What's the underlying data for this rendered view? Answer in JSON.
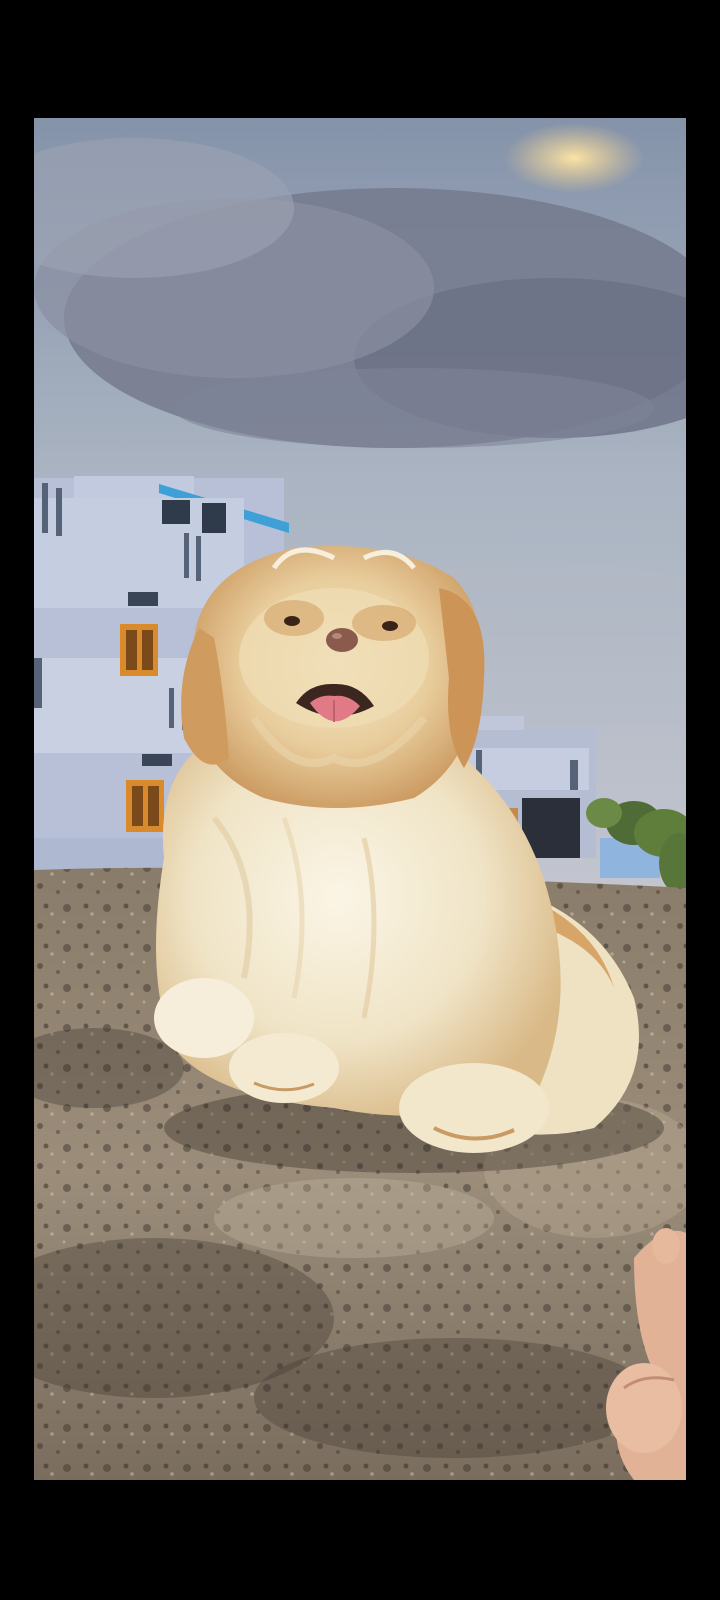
{
  "viewer": {
    "mode": "fullscreen-image",
    "background": "#000000"
  },
  "photo": {
    "subject": "dog-icon",
    "scene": [
      "sky",
      "clouds",
      "building",
      "trees",
      "stone-surface",
      "fingertip"
    ],
    "colors": {
      "sky_top": "#7f8fa6",
      "sky_mid": "#b7c0cc",
      "sky_bottom": "#c9ccd4",
      "cloud": "#6f7487",
      "cloud_highlight": "#f2cf8a",
      "building": "#b9c2d9",
      "building_trim": "#3ea0d6",
      "window": "#d98a2b",
      "ground_light": "#a89a88",
      "ground_dark": "#4a4038",
      "fur_light": "#f3ead2",
      "fur_tan": "#d8a56a",
      "nose": "#8a5a4c",
      "tongue": "#e07a86",
      "finger": "#e6b79a",
      "trees": "#5f7d3b"
    }
  }
}
